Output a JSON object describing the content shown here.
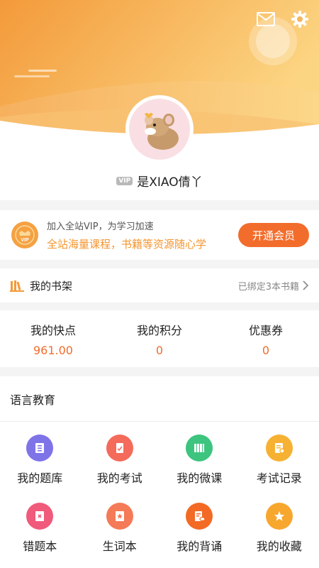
{
  "header": {
    "mail_icon": "mail-icon",
    "settings_icon": "gear-icon",
    "vip_tag": "VIP",
    "username": "是XIAO倩丫"
  },
  "vip_card": {
    "line1": "加入全站VIP，为学习加速",
    "line2": "全站海量课程，书籍等资源随心学",
    "button": "开通会员",
    "badge_text": "VIP"
  },
  "bookshelf": {
    "title": "我的书架",
    "status": "已绑定3本书籍"
  },
  "stats": [
    {
      "label": "我的快点",
      "value": "961.00"
    },
    {
      "label": "我的积分",
      "value": "0"
    },
    {
      "label": "优惠券",
      "value": "0"
    }
  ],
  "section": {
    "title": "语言教育",
    "items": [
      {
        "label": "我的题库",
        "icon": "question-bank-icon",
        "color": "#7f73e8"
      },
      {
        "label": "我的考试",
        "icon": "exam-icon",
        "color": "#f46b5b"
      },
      {
        "label": "我的微课",
        "icon": "micro-course-icon",
        "color": "#3dc47e"
      },
      {
        "label": "考试记录",
        "icon": "exam-record-icon",
        "color": "#f6b133"
      },
      {
        "label": "错题本",
        "icon": "wrong-notebook-icon",
        "color": "#f05a7b"
      },
      {
        "label": "生词本",
        "icon": "vocabulary-book-icon",
        "color": "#f47a58"
      },
      {
        "label": "我的背诵",
        "icon": "recitation-icon",
        "color": "#f36a25"
      },
      {
        "label": "我的收藏",
        "icon": "favorites-icon",
        "color": "#f8a72e"
      }
    ]
  },
  "colors": {
    "accent": "#f26d2c",
    "header_gradient_start": "#f39a3a",
    "header_gradient_end": "#fbd27a"
  }
}
